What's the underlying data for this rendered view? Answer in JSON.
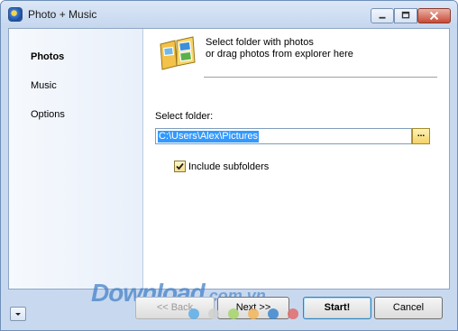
{
  "window": {
    "title": "Photo + Music"
  },
  "sidebar": {
    "items": [
      {
        "label": "Photos",
        "active": true
      },
      {
        "label": "Music",
        "active": false
      },
      {
        "label": "Options",
        "active": false
      }
    ]
  },
  "main": {
    "header_line1": "Select folder with photos",
    "header_line2": "or drag photos from explorer here",
    "select_folder_label": "Select folder:",
    "folder_path": "C:\\Users\\Alex\\Pictures",
    "browse_label": "...",
    "include_subfolders_label": "Include subfolders",
    "include_subfolders_checked": true
  },
  "footer": {
    "back_label": "<< Back",
    "next_label": "Next >>",
    "start_label": "Start!",
    "cancel_label": "Cancel"
  },
  "watermark": {
    "brand": "Download",
    "domain": ".com.vn"
  },
  "colors": {
    "selection": "#3399ff",
    "dot_colors": [
      "#5aaee8",
      "#d0d0d0",
      "#a6d46a",
      "#f2b55a",
      "#3c86cf",
      "#e26b6b"
    ]
  }
}
